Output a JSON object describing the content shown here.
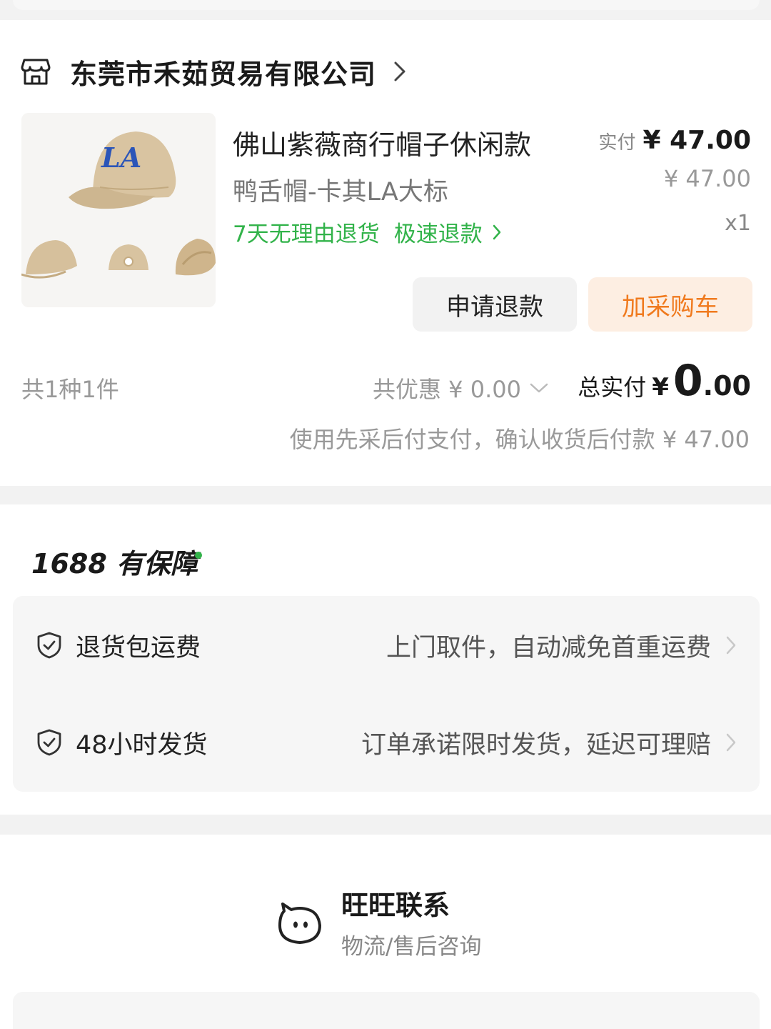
{
  "shop": {
    "name": "东莞市禾茹贸易有限公司"
  },
  "product": {
    "title": "佛山紫薇商行帽子休闲款",
    "spec": "鸭舌帽-卡其LA大标",
    "service_1": "7天无理由退货",
    "service_2": "极速退款",
    "paid_label": "实付",
    "paid_amount": "¥ 47.00",
    "original_price": "¥ 47.00",
    "quantity": "x1"
  },
  "actions": {
    "refund_label": "申请退款",
    "cart_label": "加采购车"
  },
  "summary": {
    "count_text": "共1种1件",
    "discount_text": "共优惠 ¥ 0.00",
    "total_label": "总实付",
    "total_currency": "¥",
    "total_integer": "0",
    "total_decimal": ".00",
    "pay_note": "使用先采后付支付，确认收货后付款 ¥ 47.00"
  },
  "guarantee": {
    "title": "1688 有保障",
    "items": [
      {
        "name": "退货包运费",
        "desc": "上门取件，自动减免首重运费"
      },
      {
        "name": "48小时发货",
        "desc": "订单承诺限时发货，延迟可理赔"
      }
    ]
  },
  "contact": {
    "title": "旺旺联系",
    "subtitle": "物流/售后咨询"
  },
  "colors": {
    "green": "#32b34a",
    "orange": "#f07a1e",
    "orange_bg": "#fdeee2",
    "cap": "#d8c3a0",
    "logo_blue": "#2b55b8"
  },
  "icons": {
    "store": "store-icon",
    "shield": "shield-check-icon",
    "wangwang": "wangwang-cat-icon"
  }
}
